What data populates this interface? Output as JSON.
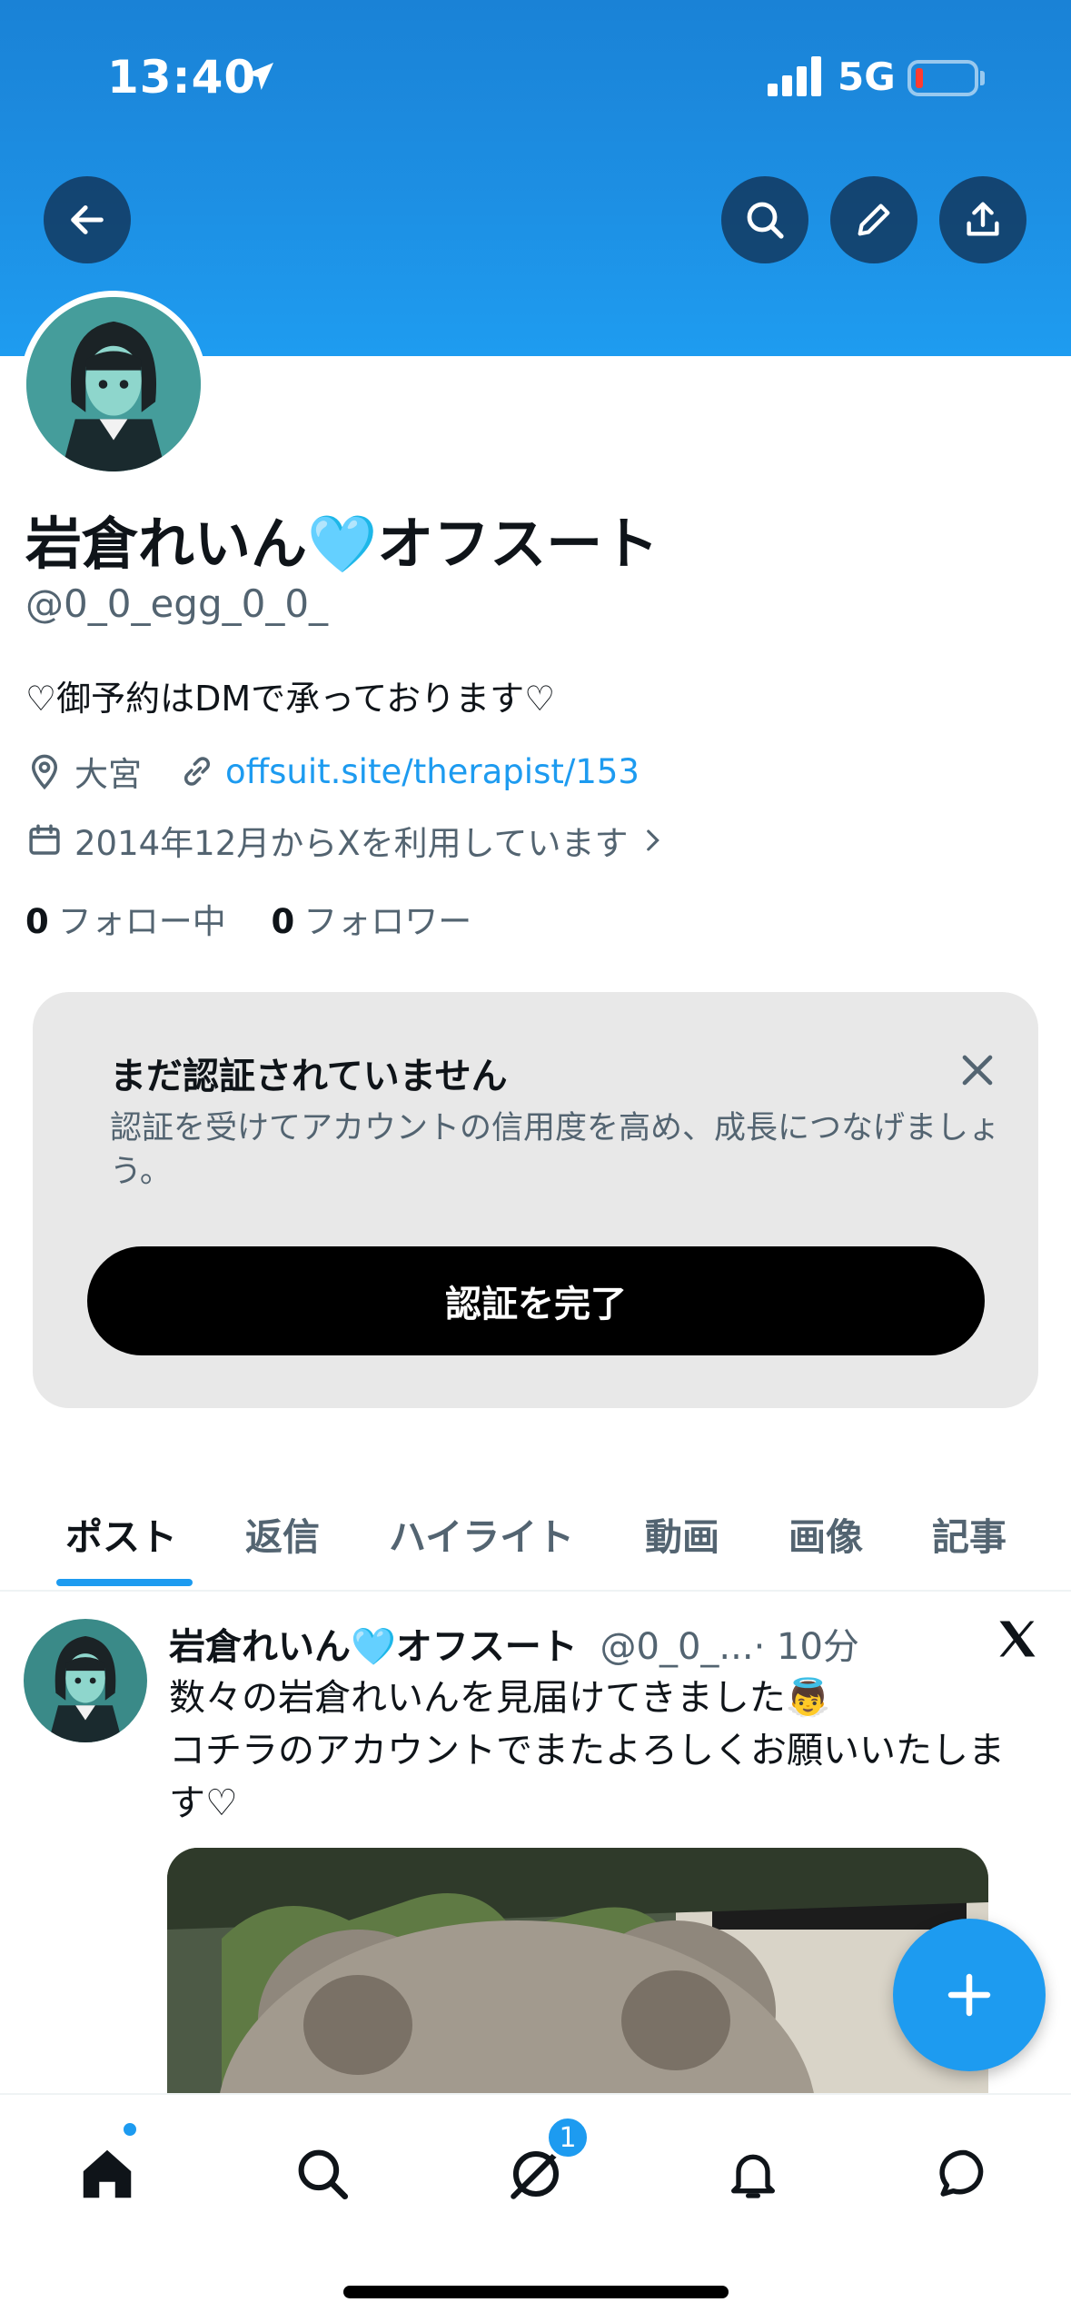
{
  "status_bar": {
    "time": "13:40",
    "network": "5G"
  },
  "profile": {
    "display_name": "岩倉れいん🩵オフスート",
    "handle": "@0_0_egg_0_0_",
    "bio": "♡御予約はDMで承っております♡",
    "location": "大宮",
    "website": "offsuit.site/therapist/153",
    "joined": "2014年12月からXを利用しています",
    "following_count": "0",
    "following_label": "フォロー中",
    "followers_count": "0",
    "followers_label": "フォロワー"
  },
  "verify_card": {
    "title": "まだ認証されていません",
    "description": "認証を受けてアカウントの信用度を高め、成長につなげましょう。",
    "button_label": "認証を完了"
  },
  "tabs": [
    "ポスト",
    "返信",
    "ハイライト",
    "動画",
    "画像",
    "記事"
  ],
  "post": {
    "name": "岩倉れいん🩵オフスート",
    "handle": "@0_0_...",
    "time": "· 10分",
    "text_line1": "数々の岩倉れいんを見届けてきました👼",
    "text_line2": "コチラのアカウントでまたよろしくお願いいたします♡"
  },
  "bottom_nav": {
    "badge_count": "1"
  },
  "colors": {
    "accent": "#1d9bf0",
    "banner": "#1d8fe3"
  }
}
